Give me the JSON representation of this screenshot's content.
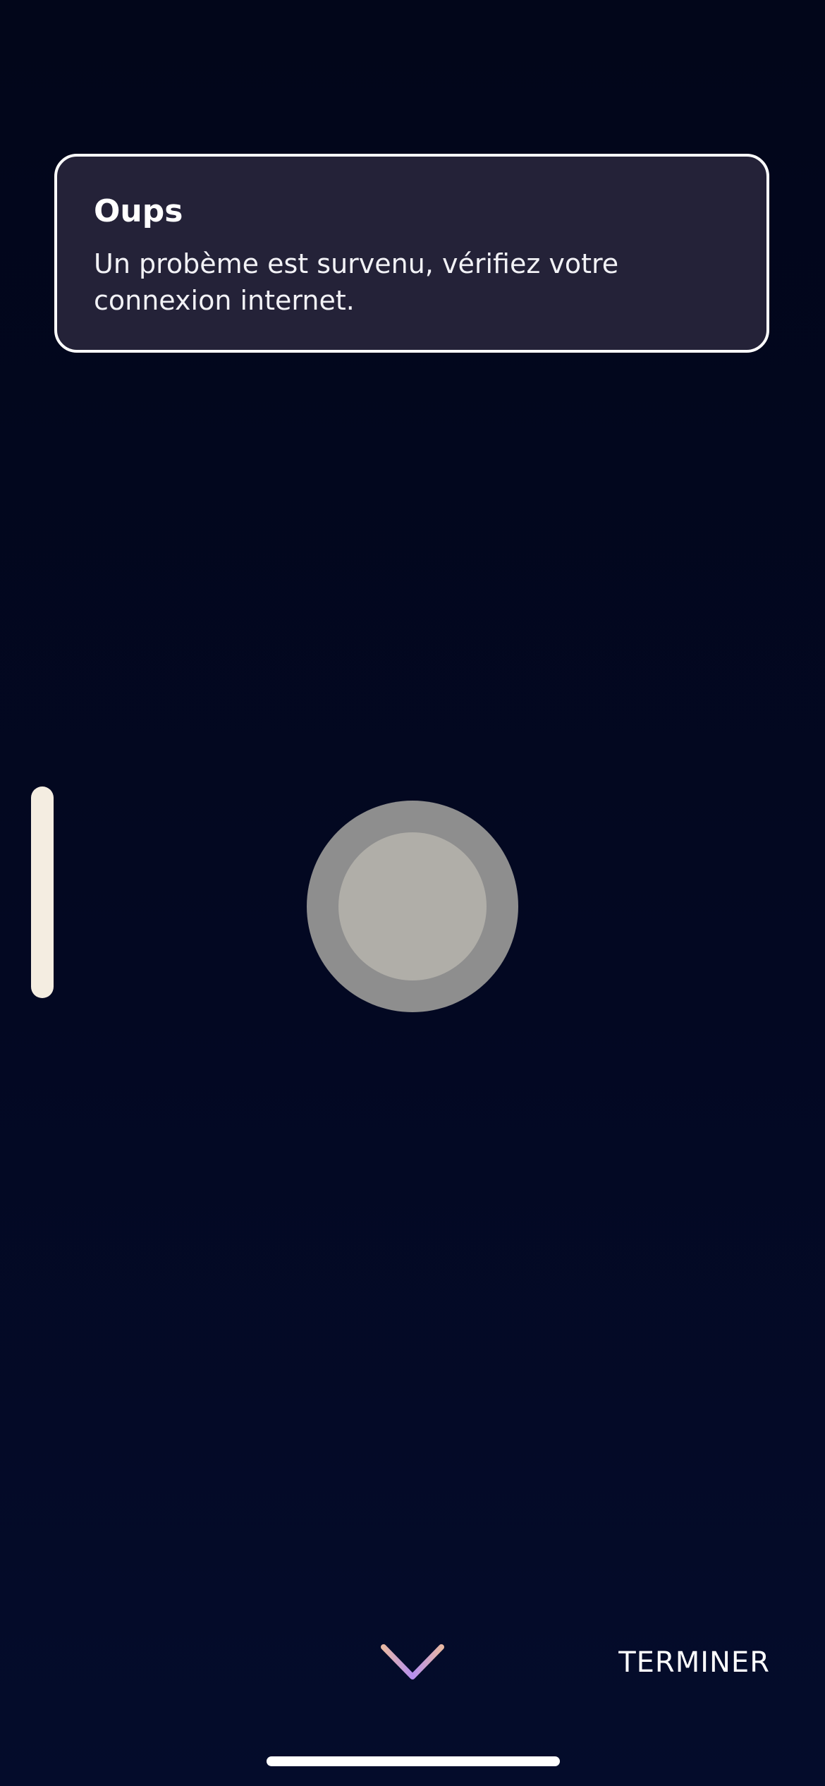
{
  "toast": {
    "title": "Oups",
    "message": "Un probème est survenu, vérifiez votre connexion internet."
  },
  "controls": {
    "finish_label": "TERMINER",
    "collapse_icon": "chevron-down-icon",
    "record_icon": "record-button"
  },
  "colors": {
    "background": "#02061a",
    "toast_background": "#242238",
    "toast_border": "#ffffff",
    "slider": "#f4ede1",
    "record_outer": "#8e8e8e",
    "record_inner": "#b0aea8",
    "chevron_gradient": [
      "#e8b8a4",
      "#b58ef0"
    ]
  }
}
